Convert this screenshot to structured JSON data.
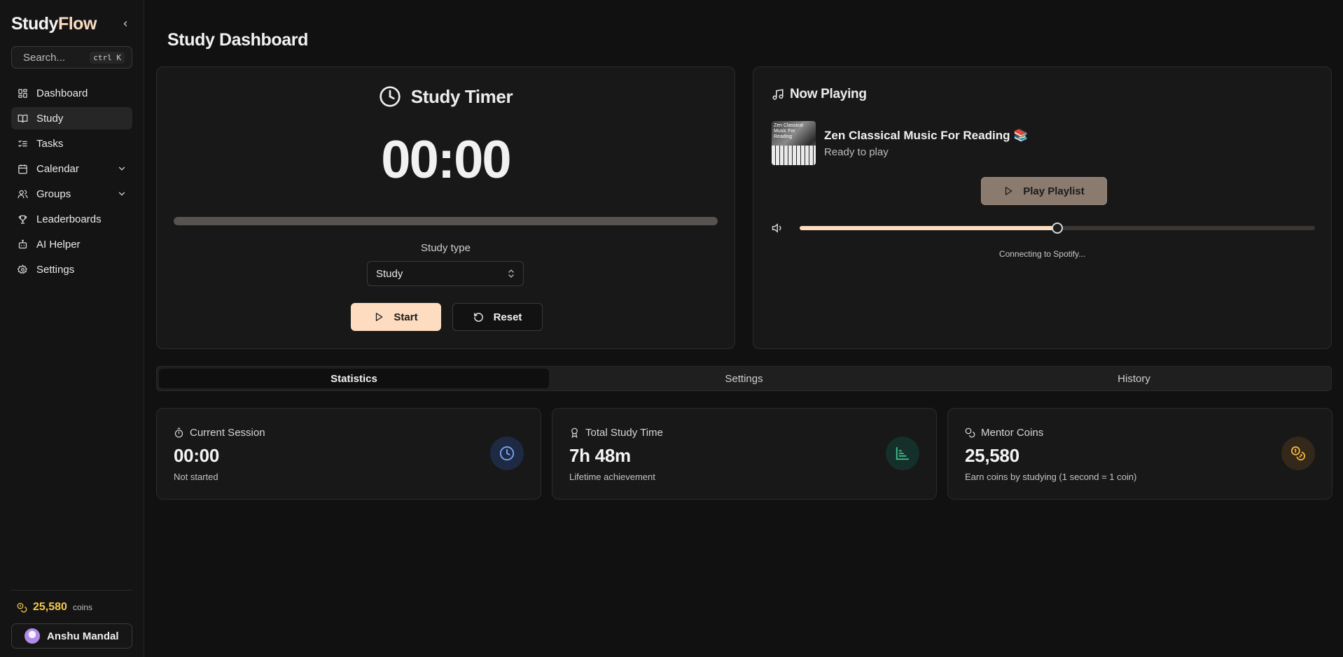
{
  "brand": {
    "name_main": "Study",
    "name_accent": "Flow"
  },
  "search": {
    "placeholder": "Search...",
    "shortcut": "ctrl K"
  },
  "nav": {
    "items": [
      {
        "label": "Dashboard",
        "icon": "dashboard-icon"
      },
      {
        "label": "Study",
        "icon": "book-icon",
        "active": true
      },
      {
        "label": "Tasks",
        "icon": "tasks-icon"
      },
      {
        "label": "Calendar",
        "icon": "calendar-icon",
        "expandable": true
      },
      {
        "label": "Groups",
        "icon": "users-icon",
        "expandable": true
      },
      {
        "label": "Leaderboards",
        "icon": "trophy-icon"
      },
      {
        "label": "AI Helper",
        "icon": "bot-icon"
      },
      {
        "label": "Settings",
        "icon": "gear-icon"
      }
    ]
  },
  "sidebar_footer": {
    "coins": "25,580",
    "coins_unit": "coins",
    "user_name": "Anshu Mandal"
  },
  "page": {
    "title": "Study Dashboard"
  },
  "timer": {
    "title": "Study Timer",
    "time": "00:00",
    "progress": 0,
    "study_type_label": "Study type",
    "study_type_value": "Study",
    "start_label": "Start",
    "reset_label": "Reset"
  },
  "now_playing": {
    "title": "Now Playing",
    "album_text": "Zen Classical Music For Reading",
    "track_title": "Zen Classical Music For Reading 📚",
    "status": "Ready to play",
    "play_label": "Play Playlist",
    "volume": 0.5,
    "connecting": "Connecting to Spotify..."
  },
  "tabs": [
    {
      "label": "Statistics",
      "active": true
    },
    {
      "label": "Settings"
    },
    {
      "label": "History"
    }
  ],
  "stats": [
    {
      "label": "Current Session",
      "value": "00:00",
      "sub": "Not started",
      "icon": "clock-icon",
      "color": "#7aa6f5"
    },
    {
      "label": "Total Study Time",
      "value": "7h 48m",
      "sub": "Lifetime achievement",
      "icon": "chart-icon",
      "color": "#3fc28d"
    },
    {
      "label": "Mentor Coins",
      "value": "25,580",
      "sub": "Earn coins by studying (1 second = 1 coin)",
      "icon": "coins-icon",
      "color": "#f0b43c"
    }
  ]
}
